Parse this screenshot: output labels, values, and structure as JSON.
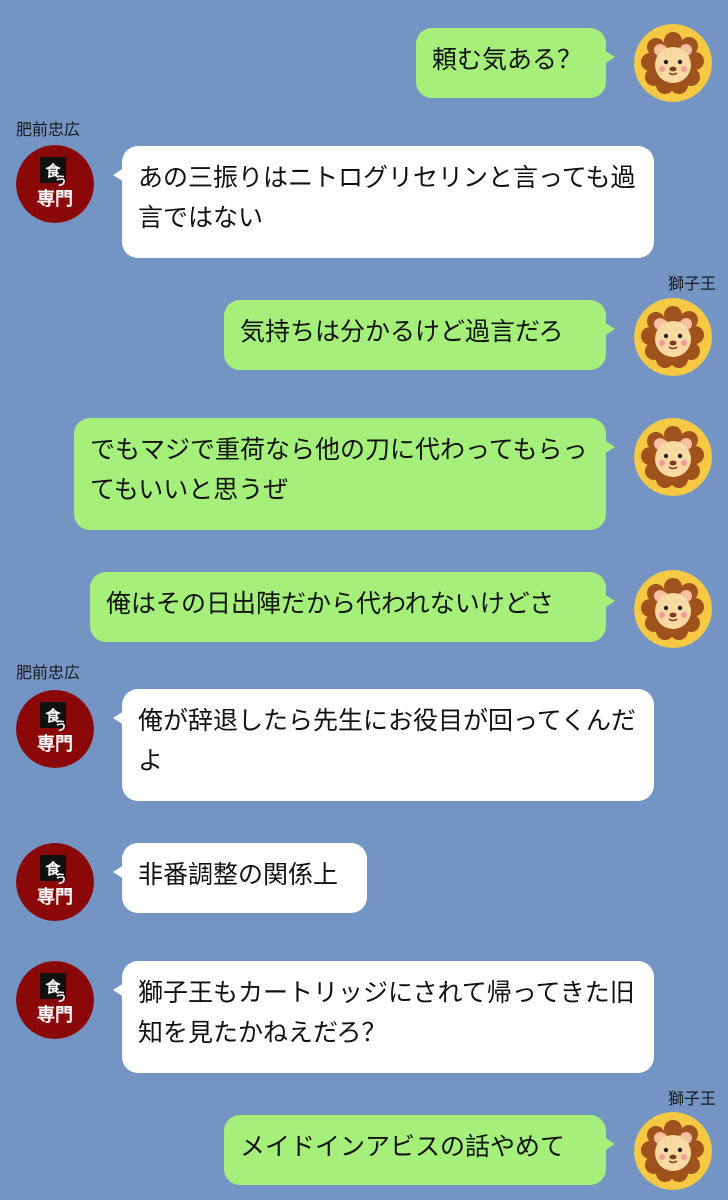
{
  "chat": {
    "name_hizen": "肥前忠広",
    "name_shishio": "獅子王",
    "avatar_hizen_text_top": "食う",
    "avatar_hizen_text_bottom": "専門",
    "messages": [
      {
        "text": "頼む気ある？"
      },
      {
        "text": "あの三振りはニトログリセリンと言っても過言ではない"
      },
      {
        "text": "気持ちは分かるけど過言だろ"
      },
      {
        "text": "でもマジで重荷なら他の刀に代わってもらってもいいと思うぜ"
      },
      {
        "text": "俺はその日出陣だから代われないけどさ"
      },
      {
        "text": "俺が辞退したら先生にお役目が回ってくんだよ"
      },
      {
        "text": "非番調整の関係上"
      },
      {
        "text": "獅子王もカートリッジにされて帰ってきた旧知を見たかねえだろ？"
      },
      {
        "text": "メイドインアビスの話やめて"
      }
    ]
  },
  "colors": {
    "background": "#7494c4",
    "me_bubble": "#a5f07a",
    "them_bubble": "#ffffff",
    "lion_bg": "#f6c944",
    "hizen_bg": "#8a0808"
  }
}
